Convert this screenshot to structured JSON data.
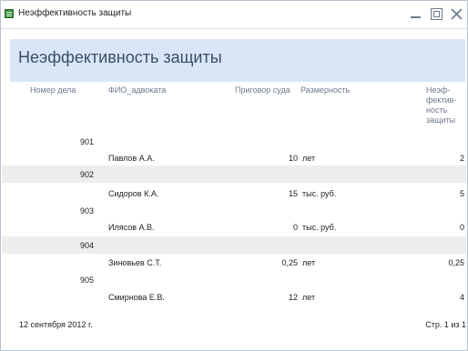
{
  "window": {
    "title": "Неэффективность защиты",
    "icon": "access-report-icon"
  },
  "report": {
    "title": "Неэффективность защиты",
    "columns": {
      "case_number": "Номер дела",
      "lawyer": "ФИО_адвоката",
      "sentence": "Приговор суда",
      "unit": "Размерность",
      "ineffectiveness": "Неэф-\nфектив-\nность\nзащиты"
    },
    "groups": [
      {
        "case": "901",
        "lawyer": "Павлов А.А.",
        "sentence": "10",
        "unit": "лет",
        "value": "2"
      },
      {
        "case": "902",
        "lawyer": "Сидоров К.А.",
        "sentence": "15",
        "unit": "тыс. руб.",
        "value": "5"
      },
      {
        "case": "903",
        "lawyer": "Илясов А.В.",
        "sentence": "0",
        "unit": "тыс. руб.",
        "value": "0"
      },
      {
        "case": "904",
        "lawyer": "Зиновьев С.Т.",
        "sentence": "0,25",
        "unit": "лет",
        "value": "0,25"
      },
      {
        "case": "905",
        "lawyer": "Смирнова Е.В.",
        "sentence": "12",
        "unit": "лет",
        "value": "4"
      }
    ],
    "footer": {
      "date": "12 сентября 2012 г.",
      "page": "Стр. 1 из 1"
    }
  }
}
